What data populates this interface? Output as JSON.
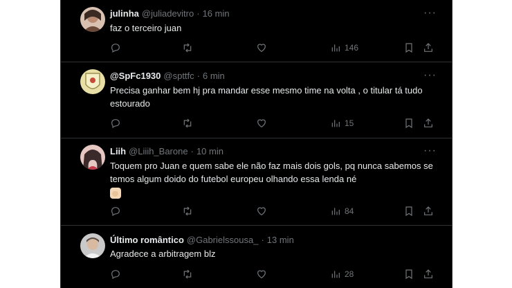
{
  "tweets": [
    {
      "name": "julinha",
      "handle": "@juliadevitro",
      "dot": "·",
      "time": "16 min",
      "text": "faz o terceiro juan",
      "views": "146",
      "avatar_colors": [
        "#6b4a3a",
        "#d9c1b2"
      ]
    },
    {
      "name": "@SpFc1930",
      "handle": "@spttfc",
      "dot": "·",
      "time": "6 min",
      "text": "Precisa ganhar bem hj pra mandar esse mesmo time na volta , o titular tá tudo estourado",
      "views": "15",
      "avatar_colors": [
        "#e8dfa7",
        "#9c8f4e"
      ]
    },
    {
      "name": "Liih",
      "handle": "@Liiih_Barone",
      "dot": "·",
      "time": "10 min",
      "text": "Toquem pro Juan e quem sabe ele não faz mais dois gols, pq nunca sabemos se temos algum doido do futebol europeu olhando essa lenda né",
      "emoji": "muscle-emoji",
      "views": "84",
      "avatar_colors": [
        "#3a2a2a",
        "#e6c7c2"
      ]
    },
    {
      "name": "Último romântico",
      "handle": "@Gabrielssousa_",
      "dot": "·",
      "time": "13 min",
      "text": "Agradece a arbitragem blz",
      "views": "28",
      "avatar_colors": [
        "#c9c9c9",
        "#5a4a42"
      ]
    }
  ],
  "more_glyph": "···",
  "icons": [
    "reply-icon",
    "retweet-icon",
    "like-icon",
    "views-icon",
    "bookmark-icon",
    "share-icon"
  ]
}
